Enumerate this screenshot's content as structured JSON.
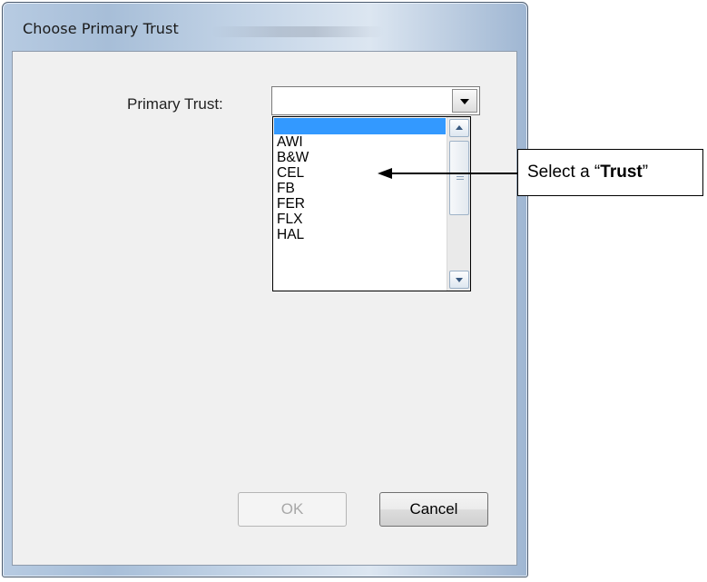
{
  "window": {
    "title": "Choose Primary Trust"
  },
  "form": {
    "primary_trust_label": "Primary Trust:",
    "primary_trust_value": ""
  },
  "dropdown": {
    "selected_index": 0,
    "items": [
      "",
      "AWI",
      "B&W",
      "CEL",
      "FB",
      "FER",
      "FLX",
      "HAL"
    ]
  },
  "buttons": {
    "ok_label": "OK",
    "ok_enabled": false,
    "cancel_label": "Cancel"
  },
  "annotation": {
    "prefix": "Select a “",
    "emphasis": "Trust",
    "suffix": "”"
  },
  "icons": {
    "combo_arrow": "chevron-down-icon",
    "scroll_up": "scroll-up-arrow-icon",
    "scroll_down": "scroll-down-arrow-icon",
    "callout_arrow": "left-arrow-icon"
  },
  "colors": {
    "selection": "#3399ff",
    "dialog_background": "#f0f0f0"
  }
}
